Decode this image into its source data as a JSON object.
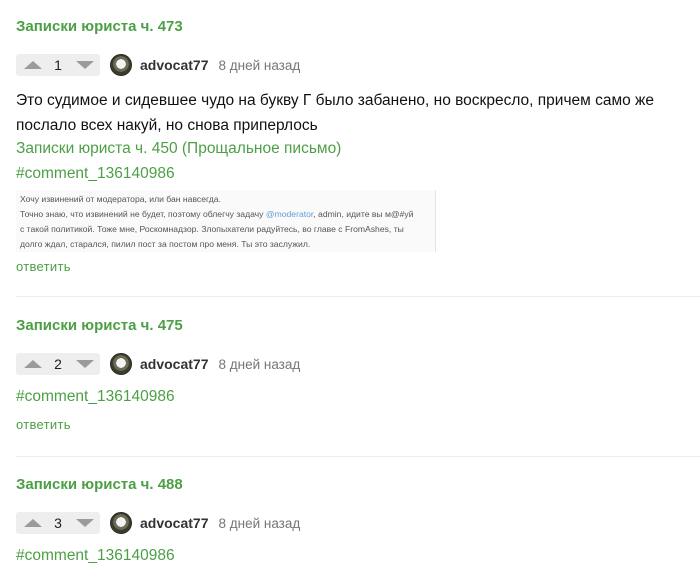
{
  "comments": [
    {
      "post_title": "Записки юриста ч. 473",
      "rating": "1",
      "author": "advocat77",
      "time": "8 дней назад",
      "text": "Это судимое и сидевшее чудо на букву Г было забанено, но воскресло, причем само же послало всех накуй, но снова приперлось",
      "link_post": "Записки юриста ч. 450 (Прощальное письмо)",
      "link_comment": "#comment_136140986",
      "quote": {
        "line1": "Хочу извинений от модератора, или бан навсегда.",
        "line2_before": "Точно знаю, что извинений не будет, поэтому облегчу задачу ",
        "line2_mention": "@moderator",
        "line2_after": ", admin, идите вы м@#уй",
        "line3": "с такой политикой. Тоже мне, Роскомнадзор. Злопыхатели радуйтесь, во главе с FromAshes, ты",
        "line4": "долго ждал, старался, пилил пост за постом про меня. Ты это заслужил."
      },
      "reply": "ответить"
    },
    {
      "post_title": "Записки юриста ч. 475",
      "rating": "2",
      "author": "advocat77",
      "time": "8 дней назад",
      "link_comment": "#comment_136140986",
      "reply": "ответить"
    },
    {
      "post_title": "Записки юриста ч. 488",
      "rating": "3",
      "author": "advocat77",
      "time": "8 дней назад",
      "link_comment": "#comment_136140986"
    }
  ],
  "icons": {
    "upvote": "triangle-up-icon",
    "downvote": "triangle-down-icon",
    "avatar": "avatar-image"
  },
  "colors": {
    "accent_green": "#4d9f46",
    "muted": "#767676",
    "vote_bg": "#eeeeee"
  }
}
